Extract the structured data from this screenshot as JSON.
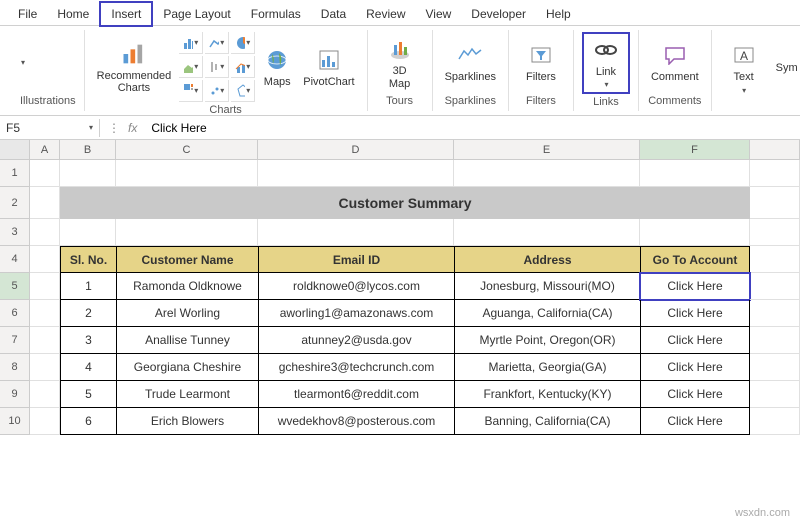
{
  "tabs": {
    "file": "File",
    "home": "Home",
    "insert": "Insert",
    "pagelayout": "Page Layout",
    "formulas": "Formulas",
    "data": "Data",
    "review": "Review",
    "view": "View",
    "developer": "Developer",
    "help": "Help"
  },
  "ribbon": {
    "illustrations_label": "Illustrations",
    "recommended_charts": "Recommended\nCharts",
    "charts_label": "Charts",
    "maps": "Maps",
    "pivotchart": "PivotChart",
    "threed_map": "3D\nMap",
    "tours_label": "Tours",
    "sparklines": "Sparklines",
    "sparklines_label": "Sparklines",
    "filters": "Filters",
    "filters_label": "Filters",
    "link": "Link",
    "links_label": "Links",
    "comment": "Comment",
    "comments_label": "Comments",
    "text": "Text",
    "sym": "Sym"
  },
  "formula_bar": {
    "namebox": "F5",
    "fx": "fx",
    "value": "Click Here"
  },
  "columns": [
    "A",
    "B",
    "C",
    "D",
    "E",
    "F"
  ],
  "title": "Customer Summary",
  "headers": {
    "sl": "Sl. No.",
    "name": "Customer Name",
    "email": "Email ID",
    "address": "Address",
    "goto": "Go To Account"
  },
  "rows": [
    {
      "n": "1",
      "name": "Ramonda Oldknowe",
      "email": "roldknowe0@lycos.com",
      "addr": "Jonesburg, Missouri(MO)",
      "link": "Click Here"
    },
    {
      "n": "2",
      "name": "Arel Worling",
      "email": "aworling1@amazonaws.com",
      "addr": "Aguanga, California(CA)",
      "link": "Click Here"
    },
    {
      "n": "3",
      "name": "Anallise Tunney",
      "email": "atunney2@usda.gov",
      "addr": "Myrtle Point, Oregon(OR)",
      "link": "Click Here"
    },
    {
      "n": "4",
      "name": "Georgiana Cheshire",
      "email": "gcheshire3@techcrunch.com",
      "addr": "Marietta, Georgia(GA)",
      "link": "Click Here"
    },
    {
      "n": "5",
      "name": "Trude Learmont",
      "email": "tlearmont6@reddit.com",
      "addr": "Frankfort, Kentucky(KY)",
      "link": "Click Here"
    },
    {
      "n": "6",
      "name": "Erich Blowers",
      "email": "wvedekhov8@posterous.com",
      "addr": "Banning, California(CA)",
      "link": "Click Here"
    }
  ],
  "rownums": [
    "1",
    "2",
    "3",
    "4",
    "5",
    "6",
    "7",
    "8",
    "9",
    "10"
  ],
  "watermark": "wsxdn.com"
}
